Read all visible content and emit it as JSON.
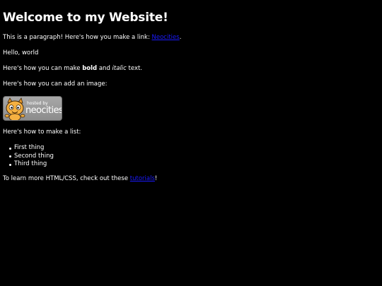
{
  "heading": "Welcome to my Website!",
  "para_link": {
    "before": "This is a paragraph! Here's how you make a link: ",
    "link_text": "Neocities",
    "after": "."
  },
  "hello": "Hello, world",
  "format": {
    "before": "Here's how you can make ",
    "bold": "bold",
    "middle": " and ",
    "italic": "italic",
    "after": " text."
  },
  "image_intro": "Here's how you can add an image:",
  "badge": {
    "small_text": "hosted by",
    "brand_text": "neocities",
    "icon": "neocities-cat-logo"
  },
  "list_intro": "Here's how to make a list:",
  "list_items": [
    "First thing",
    "Second thing",
    "Third thing"
  ],
  "learn_more": {
    "before": "To learn more HTML/CSS, check out these ",
    "link_text": "tutorials",
    "after": "!"
  },
  "colors": {
    "background": "#000000",
    "text": "#ffffff",
    "link": "#1a1aff"
  }
}
